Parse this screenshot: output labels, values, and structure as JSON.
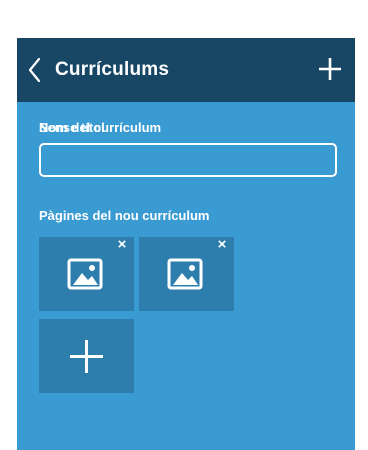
{
  "header": {
    "title": "Currículums",
    "back_icon": "chevron-left-icon",
    "add_icon": "plus-icon"
  },
  "form": {
    "name_label": "Nom del currículum",
    "name_label_overlay": "Sense títol",
    "name_value": "",
    "pages_label": "Pàgines del nou currículum"
  },
  "pages": [
    {
      "icon": "image-icon",
      "remove_label": "×"
    },
    {
      "icon": "image-icon",
      "remove_label": "×"
    }
  ],
  "add_page_icon": "plus-icon",
  "colors": {
    "header_bg": "#174765",
    "panel_bg": "#3a9bd2",
    "tile_bg": "#2d7eac",
    "text": "#ffffff"
  }
}
